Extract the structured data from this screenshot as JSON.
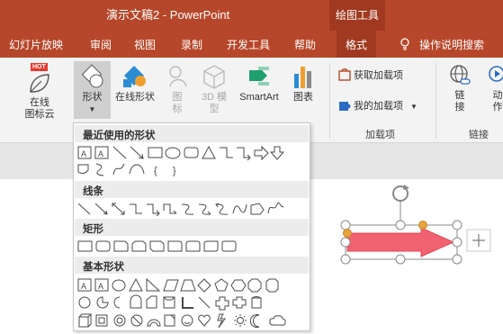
{
  "window": {
    "title": "演示文稿2  -  PowerPoint",
    "context_tab_group": "绘图工具"
  },
  "tabs": [
    "幻灯片放映",
    "审阅",
    "视图",
    "录制",
    "开发工具",
    "帮助",
    "格式"
  ],
  "active_tab": "格式",
  "tell_me": "操作说明搜索",
  "ribbon": {
    "online_icon": {
      "badge": "HOT",
      "label1": "在线",
      "label2": "图标云"
    },
    "shapes": {
      "label": "形状"
    },
    "online_shapes": {
      "label": "在线形状"
    },
    "icons": {
      "label1": "图",
      "label2": "标"
    },
    "models3d": {
      "label1": "3D 模",
      "label2": "型"
    },
    "smartart": {
      "label": "SmartArt"
    },
    "chart": {
      "label": "图表"
    },
    "get_addins": {
      "label": "获取加载项"
    },
    "my_addins": {
      "label": "我的加载项"
    },
    "addins_group": "加载项",
    "link": {
      "label1": "链",
      "label2": "接"
    },
    "link_group": "链接",
    "action": {
      "label1": "动",
      "label2": "作"
    }
  },
  "shapes_menu": {
    "sections": [
      {
        "title": "最近使用的形状"
      },
      {
        "title": "线条"
      },
      {
        "title": "矩形"
      },
      {
        "title": "基本形状"
      }
    ],
    "textbox_glyph": "A",
    "brace_open": "{",
    "brace_close": "}"
  },
  "colors": {
    "accent": "#b7472a",
    "accent_dark": "#a0391f",
    "arrow_fill": "#f0626f",
    "handle": "#e8a33c"
  }
}
